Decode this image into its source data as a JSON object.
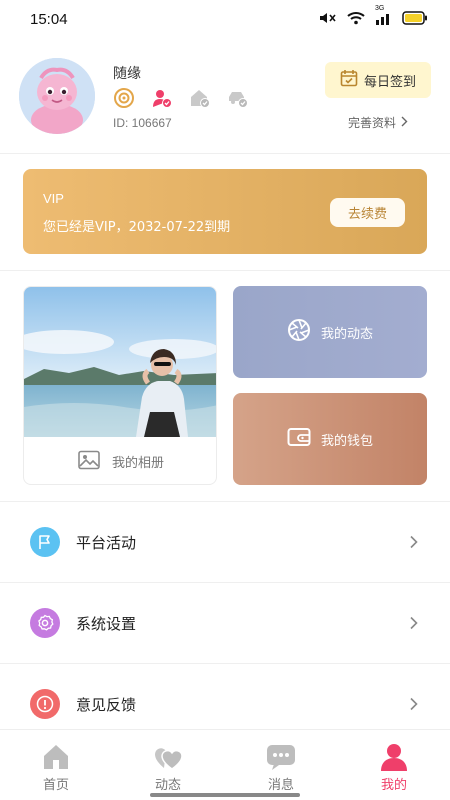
{
  "status_bar": {
    "time": "15:04",
    "network": "3G"
  },
  "profile": {
    "nickname": "随缘",
    "user_id": "ID: 106667",
    "badges": [
      "target-badge-icon",
      "verified-person-icon",
      "house-check-icon",
      "car-check-icon"
    ],
    "checkin_label": "每日签到",
    "complete_profile_label": "完善资料"
  },
  "vip": {
    "title": "VIP",
    "description": "您已经是VIP，2032-07-22到期",
    "renew_label": "去续费"
  },
  "shortcuts": {
    "album_label": "我的相册",
    "moments_label": "我的动态",
    "wallet_label": "我的钱包"
  },
  "menu": [
    {
      "label": "平台活动",
      "icon": "flag-icon",
      "color": "#5bc2f2"
    },
    {
      "label": "系统设置",
      "icon": "gear-icon",
      "color": "#c57be0"
    },
    {
      "label": "意见反馈",
      "icon": "info-icon",
      "color": "#f16a6a"
    }
  ],
  "tabs": [
    {
      "label": "首页",
      "icon": "home-icon",
      "active": false
    },
    {
      "label": "动态",
      "icon": "hearts-icon",
      "active": false
    },
    {
      "label": "消息",
      "icon": "chat-icon",
      "active": false
    },
    {
      "label": "我的",
      "icon": "person-icon",
      "active": true
    }
  ],
  "colors": {
    "accent": "#ef3f6a",
    "vip_gold": "#e3b066",
    "checkin_bg": "#fff6cf"
  }
}
